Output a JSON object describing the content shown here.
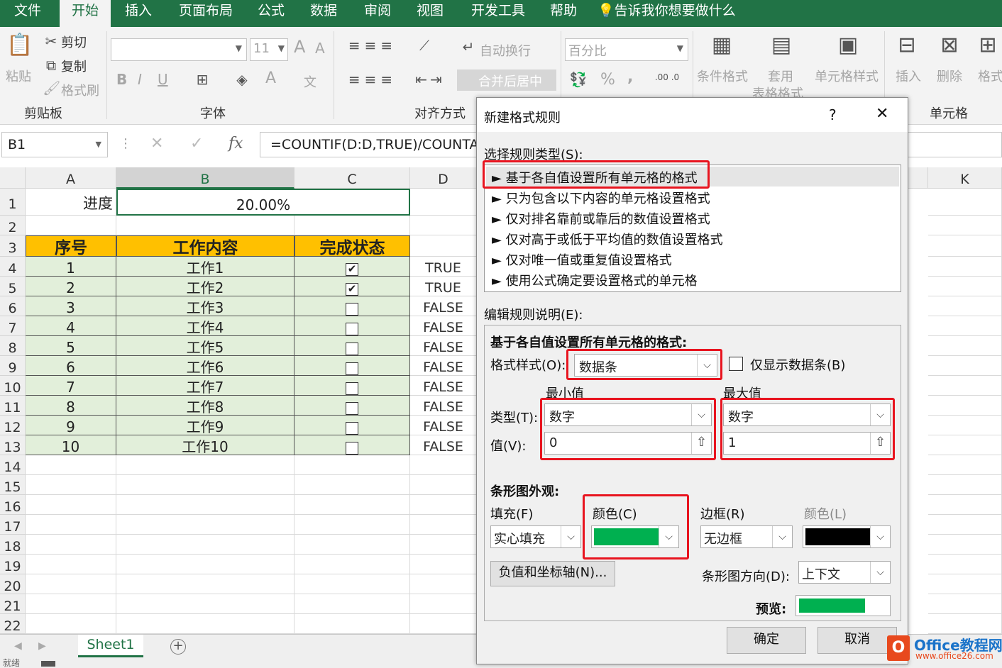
{
  "ribbon_tabs": [
    "文件",
    "开始",
    "插入",
    "页面布局",
    "公式",
    "数据",
    "审阅",
    "视图",
    "开发工具",
    "帮助"
  ],
  "tell_me": "告诉我你想要做什么",
  "clipboard": {
    "paste": "粘贴",
    "cut": "剪切",
    "copy": "复制",
    "format_painter": "格式刷",
    "group": "剪贴板"
  },
  "font": {
    "size": "11",
    "bold": "B",
    "italic": "I",
    "underline": "U",
    "group": "字体",
    "grow": "A",
    "shrink": "A",
    "fontcolor": "A",
    "phonetic": "文"
  },
  "alignment": {
    "wrap": "自动换行",
    "merge": "合并后居中",
    "group": "对齐方式"
  },
  "number": {
    "format": "百分比",
    "percent": "%",
    "comma": ","
  },
  "styles": {
    "conditional": "条件格式",
    "table_1": "套用",
    "table_2": "表格格式",
    "cell_styles": "单元格样式"
  },
  "cells": {
    "insert": "插入",
    "delete": "删除",
    "format": "格式",
    "group": "单元格"
  },
  "namebox": "B1",
  "formula": "=COUNTIF(D:D,TRUE)/COUNTA(",
  "fx": "fx",
  "columns": [
    "A",
    "B",
    "C",
    "D",
    "K"
  ],
  "rows": [
    "1",
    "2",
    "3",
    "4",
    "5",
    "6",
    "7",
    "8",
    "9",
    "10",
    "11",
    "12",
    "13",
    "14",
    "15",
    "16",
    "17",
    "18",
    "19",
    "20",
    "21",
    "22"
  ],
  "cells_data": {
    "a1": "进度",
    "b1": "20.00%",
    "headers": [
      "序号",
      "工作内容",
      "完成状态"
    ],
    "table": [
      {
        "n": "1",
        "task": "工作1",
        "checked": true,
        "d": "TRUE"
      },
      {
        "n": "2",
        "task": "工作2",
        "checked": true,
        "d": "TRUE"
      },
      {
        "n": "3",
        "task": "工作3",
        "checked": false,
        "d": "FALSE"
      },
      {
        "n": "4",
        "task": "工作4",
        "checked": false,
        "d": "FALSE"
      },
      {
        "n": "5",
        "task": "工作5",
        "checked": false,
        "d": "FALSE"
      },
      {
        "n": "6",
        "task": "工作6",
        "checked": false,
        "d": "FALSE"
      },
      {
        "n": "7",
        "task": "工作7",
        "checked": false,
        "d": "FALSE"
      },
      {
        "n": "8",
        "task": "工作8",
        "checked": false,
        "d": "FALSE"
      },
      {
        "n": "9",
        "task": "工作9",
        "checked": false,
        "d": "FALSE"
      },
      {
        "n": "10",
        "task": "工作10",
        "checked": false,
        "d": "FALSE"
      }
    ]
  },
  "sheet_tab": "Sheet1",
  "status_text": "就绪",
  "dialog": {
    "title": "新建格式规则",
    "help": "?",
    "close": "✕",
    "select_type_label": "选择规则类型(S):",
    "rule_types": [
      "► 基于各自值设置所有单元格的格式",
      "► 只为包含以下内容的单元格设置格式",
      "► 仅对排名靠前或靠后的数值设置格式",
      "► 仅对高于或低于平均值的数值设置格式",
      "► 仅对唯一值或重复值设置格式",
      "► 使用公式确定要设置格式的单元格"
    ],
    "edit_label": "编辑规则说明(E):",
    "section_title": "基于各自值设置所有单元格的格式:",
    "format_style_label": "格式样式(O):",
    "format_style": "数据条",
    "show_bar_only": "仅显示数据条(B)",
    "min_label": "最小值",
    "max_label": "最大值",
    "type_label": "类型(T):",
    "value_label": "值(V):",
    "min_type": "数字",
    "max_type": "数字",
    "min_value": "0",
    "max_value": "1",
    "appearance": "条形图外观:",
    "fill_label": "填充(F)",
    "fill_value": "实心填充",
    "color_label": "颜色(C)",
    "bar_color": "#00b050",
    "border_label": "边框(R)",
    "border_value": "无边框",
    "border_color_label": "颜色(L)",
    "border_color": "#000000",
    "negative_btn": "负值和坐标轴(N)...",
    "direction_label": "条形图方向(D):",
    "direction_value": "上下文",
    "preview_label": "预览:",
    "preview_fill": 0.75,
    "ok": "确定",
    "cancel": "取消"
  },
  "watermark": {
    "brand": "Office教程网",
    "url": "www.office26.com"
  }
}
